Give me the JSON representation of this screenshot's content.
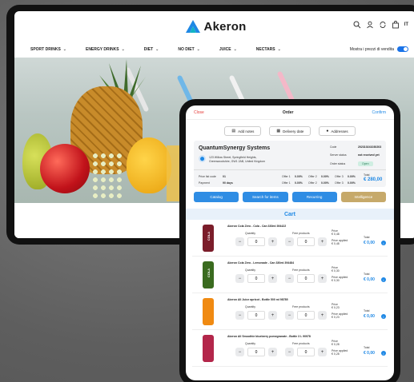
{
  "site": {
    "brand": "Akeron",
    "lang": "IT",
    "nav": [
      "SPORT DRINKS",
      "ENERGY DRINKS",
      "DIET",
      "NO DIET",
      "JUICE",
      "NECTARS"
    ],
    "toggle_label": "Mostra i prezzi di vendita"
  },
  "order": {
    "close": "Close",
    "title": "Order",
    "confirm": "Confirm",
    "tabs": [
      "Add notes",
      "Delivery date",
      "Addresses"
    ],
    "customer": {
      "name": "QuantumSynergy Systems",
      "address": "123 Willow Street, Springfield Heights, Greenwoodshire, GW1 2AB, United Kingdom",
      "code_label": "Code",
      "code_value": "202310241030203",
      "server_status_label": "Server status",
      "server_status_value": "not received yet",
      "order_status_label": "Order status",
      "order_status_value": "Open"
    },
    "pricing": {
      "price_list_label": "Price list code",
      "price_list_value": "01",
      "payment_label": "Payment",
      "payment_value": "90 days",
      "offers": [
        {
          "label": "Offer 1",
          "value": "0.00%"
        },
        {
          "label": "Offer 2",
          "value": "0.00%"
        },
        {
          "label": "Offer 3",
          "value": "0.00%"
        },
        {
          "label": "Offer 1",
          "value": "0.00%"
        },
        {
          "label": "Offer 2",
          "value": "0.00%"
        },
        {
          "label": "Offer 3",
          "value": "0.00%"
        }
      ],
      "total_label": "Total",
      "total_value": "€ 280,00"
    },
    "actions": [
      "Catalog",
      "Search for items",
      "Recurring",
      "Intelligence"
    ],
    "cart_title": "Cart",
    "labels": {
      "quantity": "Quantity",
      "free_products": "Free products",
      "price": "Price",
      "price_applied": "Price applied",
      "total": "Total"
    },
    "items": [
      {
        "name": "Akeron Cola Zero - Cola - Can 330ml 394422",
        "qty": "0",
        "free": "0",
        "price": "€ 0,48",
        "applied": "€ 0,48",
        "total": "€ 0,00",
        "color": "#7b1d2a",
        "tag": "COLA"
      },
      {
        "name": "Akeron Cola Zero - Lemonade - Can 330ml 394484",
        "qty": "0",
        "free": "0",
        "price": "€ 0,30",
        "applied": "€ 0,30",
        "total": "€ 0,00",
        "color": "#3a6b1f",
        "tag": "COLA"
      },
      {
        "name": "Akeron All Juice apricot - Bottle 500 ml 98785",
        "qty": "0",
        "free": "0",
        "price": "€ 0,23",
        "applied": "€ 0,23",
        "total": "€ 0,00",
        "color": "#f08a12",
        "tag": ""
      },
      {
        "name": "Akeron All Smoothie blueberry pomegranate - Bottle 3 L 90978",
        "qty": "0",
        "free": "0",
        "price": "€ 0,28",
        "applied": "€ 0,28",
        "total": "€ 0,00",
        "color": "#b3264a",
        "tag": ""
      }
    ]
  }
}
